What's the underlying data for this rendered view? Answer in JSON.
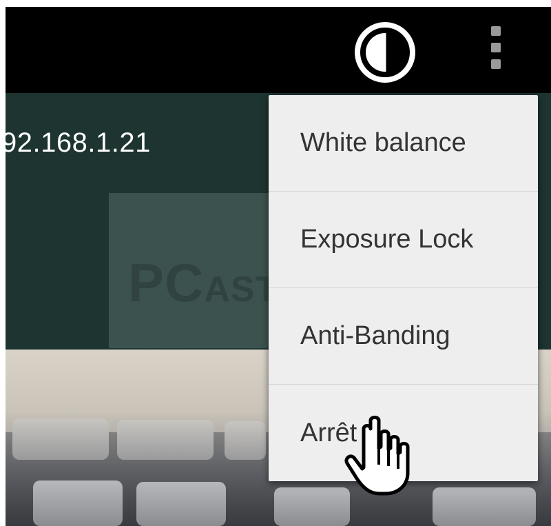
{
  "toolbar": {
    "contrast_icon": "contrast-icon",
    "overflow_icon": "more-vert-icon"
  },
  "camera_view": {
    "ip_address": "92.168.1.21"
  },
  "watermark": {
    "pc": "PC",
    "rest": "ASTUCES"
  },
  "overflow_menu": {
    "items": [
      {
        "label": "White balance"
      },
      {
        "label": "Exposure Lock"
      },
      {
        "label": "Anti-Banding"
      },
      {
        "label": "Arrêt"
      }
    ]
  },
  "cursor_icon": "hand-pointer-icon",
  "colors": {
    "topbar": "#000000",
    "background": "#1d3431",
    "menu_bg": "#eeeeee",
    "menu_text": "#333333",
    "divider": "#d6d6d6"
  }
}
